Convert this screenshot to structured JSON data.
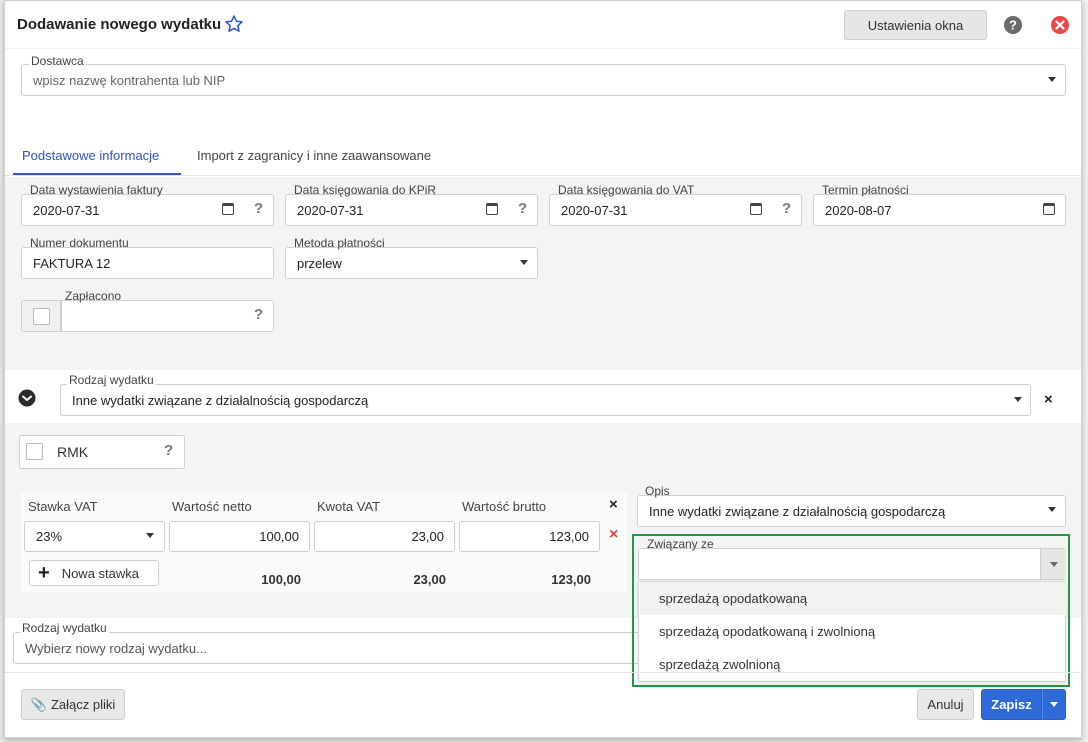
{
  "header": {
    "title": "Dodawanie nowego wydatku",
    "settings_label": "Ustawienia okna"
  },
  "supplier": {
    "label": "Dostawca",
    "placeholder": "wpisz nazwę kontrahenta lub NIP"
  },
  "tabs": [
    {
      "label": "Podstawowe informacje",
      "active": true
    },
    {
      "label": "Import z zagranicy i inne zaawansowane",
      "active": false
    }
  ],
  "dates": {
    "issue": {
      "label": "Data wystawienia faktury",
      "value": "2020-07-31"
    },
    "kpir": {
      "label": "Data księgowania do KPiR",
      "value": "2020-07-31"
    },
    "vat": {
      "label": "Data księgowania do VAT",
      "value": "2020-07-31"
    },
    "due": {
      "label": "Termin płatności",
      "value": "2020-08-07"
    }
  },
  "document_number": {
    "label": "Numer dokumentu",
    "value": "FAKTURA 12"
  },
  "payment_method": {
    "label": "Metoda płatności",
    "value": "przelew"
  },
  "paid": {
    "label": "Zapłacono",
    "value": ""
  },
  "expense_type": {
    "label": "Rodzaj wydatku",
    "value": "Inne wydatki związane z działalnością gospodarczą"
  },
  "rmk": {
    "label": "RMK"
  },
  "vat_table": {
    "headers": [
      "Stawka VAT",
      "Wartość netto",
      "Kwota VAT",
      "Wartość brutto"
    ],
    "rows": [
      {
        "rate": "23%",
        "net": "100,00",
        "vat": "23,00",
        "gross": "123,00"
      }
    ],
    "add_label": "Nowa stawka",
    "totals": {
      "net": "100,00",
      "vat": "23,00",
      "gross": "123,00"
    }
  },
  "description": {
    "label": "Opis",
    "value": "Inne wydatki związane z działalnością gospodarczą"
  },
  "related": {
    "label": "Związany ze",
    "value": "",
    "options": [
      "sprzedażą opodatkowaną",
      "sprzedażą opodatkowaną i zwolnioną",
      "sprzedażą zwolnioną"
    ]
  },
  "new_expense_type": {
    "label": "Rodzaj wydatku",
    "placeholder": "Wybierz nowy rodzaj wydatku..."
  },
  "footer": {
    "attach_label": "Załącz pliki",
    "cancel_label": "Anuluj",
    "save_label": "Zapisz"
  },
  "colors": {
    "accent": "#2f6bd8",
    "highlight_border": "#1e9b3c",
    "danger": "#e84040"
  }
}
